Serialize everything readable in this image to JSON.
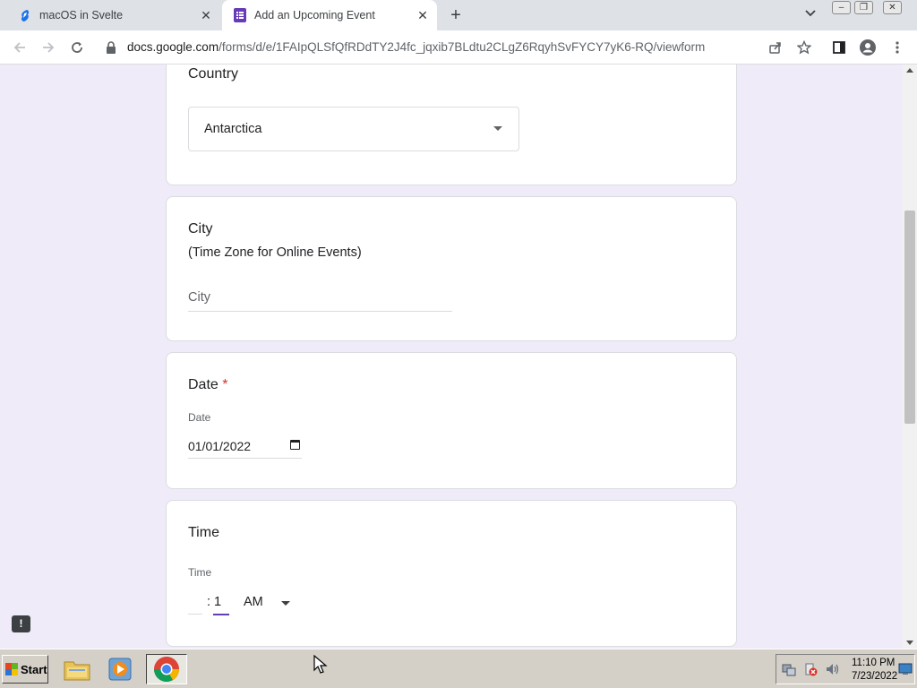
{
  "browser": {
    "tabs": [
      {
        "title": "macOS in Svelte",
        "active": false
      },
      {
        "title": "Add an Upcoming Event",
        "active": true
      }
    ],
    "url_host": "docs.google.com",
    "url_path": "/forms/d/e/1FAIpQLSfQfRDdTY2J4fc_jqxib7BLdtu2CLgZ6RqyhSvFYCY7yK6-RQ/viewform"
  },
  "form": {
    "country": {
      "title": "Country",
      "selected": "Antarctica"
    },
    "city": {
      "title": "City",
      "subtitle": "(Time Zone for Online Events)",
      "placeholder": "City"
    },
    "date": {
      "title": "Date",
      "required_mark": "*",
      "label": "Date",
      "value": "01/01/2022"
    },
    "time": {
      "title": "Time",
      "label": "Time",
      "colon": ":",
      "minute": "1",
      "ampm": "AM"
    }
  },
  "feedback": {
    "icon": "!"
  },
  "taskbar": {
    "start_label": "Start",
    "clock_time": "11:10 PM",
    "clock_date": "7/23/2022"
  },
  "colors": {
    "page_background": "#f0ebf8",
    "accent": "#673ab7",
    "required": "#d93025"
  }
}
